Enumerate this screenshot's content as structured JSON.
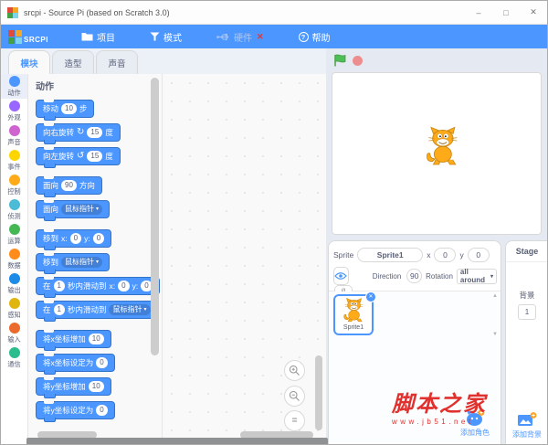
{
  "window": {
    "title": "srcpi - Source Pi (based on Scratch 3.0)"
  },
  "icons": {
    "minimize": "–",
    "maximize": "□",
    "close": "✕",
    "caret_down": "▾",
    "rotate_cw": "↻",
    "rotate_ccw": "↺",
    "help_q": "?",
    "hardware_x": "✕",
    "scroll_up": "▲",
    "scroll_down": "▼",
    "zoom_reset": "=",
    "sprite_close": "✕",
    "hide_eye": "ø"
  },
  "menu": {
    "brand": "SRCPI",
    "items": [
      {
        "label": "项目",
        "disabled": false
      },
      {
        "label": "模式",
        "disabled": false
      },
      {
        "label": "硬件",
        "disabled": true
      },
      {
        "label": "帮助",
        "disabled": false
      }
    ]
  },
  "tabs": [
    {
      "label": "模块",
      "active": true
    },
    {
      "label": "造型",
      "active": false
    },
    {
      "label": "声音",
      "active": false
    }
  ],
  "categories": [
    {
      "label": "动作",
      "color": "#4C97FF",
      "selected": true
    },
    {
      "label": "外观",
      "color": "#9966FF",
      "selected": false
    },
    {
      "label": "声音",
      "color": "#CF63CF",
      "selected": false
    },
    {
      "label": "事件",
      "color": "#FFD500",
      "selected": false
    },
    {
      "label": "控制",
      "color": "#FFAB19",
      "selected": false
    },
    {
      "label": "侦测",
      "color": "#4CBCD6",
      "selected": false
    },
    {
      "label": "运算",
      "color": "#45B854",
      "selected": false
    },
    {
      "label": "数据",
      "color": "#FF8C1A",
      "selected": false
    },
    {
      "label": "输出",
      "color": "#1C8CE8",
      "selected": false
    },
    {
      "label": "感知",
      "color": "#E0B50E",
      "selected": false
    },
    {
      "label": "输入",
      "color": "#EB6B2E",
      "selected": false
    },
    {
      "label": "通信",
      "color": "#2BBD8E",
      "selected": false
    }
  ],
  "palette": {
    "header": "动作",
    "blocks": [
      {
        "gap": false,
        "parts": [
          [
            "t",
            "移动"
          ],
          [
            "n",
            "10"
          ],
          [
            "t",
            "步"
          ]
        ]
      },
      {
        "gap": false,
        "parts": [
          [
            "t",
            "向右旋转"
          ],
          [
            "i",
            "↻"
          ],
          [
            "n",
            "15"
          ],
          [
            "t",
            "度"
          ]
        ]
      },
      {
        "gap": false,
        "parts": [
          [
            "t",
            "向左旋转"
          ],
          [
            "i",
            "↺"
          ],
          [
            "n",
            "15"
          ],
          [
            "t",
            "度"
          ]
        ]
      },
      {
        "gap": true,
        "parts": [
          [
            "t",
            "面向"
          ],
          [
            "n",
            "90"
          ],
          [
            "t",
            "方向"
          ]
        ]
      },
      {
        "gap": false,
        "parts": [
          [
            "t",
            "面向"
          ],
          [
            "d",
            "鼠标指针"
          ]
        ]
      },
      {
        "gap": true,
        "parts": [
          [
            "t",
            "移到"
          ],
          [
            "t",
            "x:"
          ],
          [
            "n",
            "0"
          ],
          [
            "t",
            "y:"
          ],
          [
            "n",
            "0"
          ]
        ]
      },
      {
        "gap": false,
        "parts": [
          [
            "t",
            "移到"
          ],
          [
            "d",
            "鼠标指针"
          ]
        ]
      },
      {
        "gap": false,
        "parts": [
          [
            "t",
            "在"
          ],
          [
            "n",
            "1"
          ],
          [
            "t",
            "秒内滑动到"
          ],
          [
            "t",
            "x:"
          ],
          [
            "n",
            "0"
          ],
          [
            "t",
            "y:"
          ],
          [
            "n",
            "0"
          ]
        ]
      },
      {
        "gap": false,
        "parts": [
          [
            "t",
            "在"
          ],
          [
            "n",
            "1"
          ],
          [
            "t",
            "秒内滑动到"
          ],
          [
            "d",
            "鼠标指针"
          ]
        ]
      },
      {
        "gap": true,
        "parts": [
          [
            "t",
            "将x坐标增加"
          ],
          [
            "n",
            "10"
          ]
        ]
      },
      {
        "gap": false,
        "parts": [
          [
            "t",
            "将x坐标设定为"
          ],
          [
            "n",
            "0"
          ]
        ]
      },
      {
        "gap": false,
        "parts": [
          [
            "t",
            "将y坐标增加"
          ],
          [
            "n",
            "10"
          ]
        ]
      },
      {
        "gap": false,
        "parts": [
          [
            "t",
            "将y坐标设定为"
          ],
          [
            "n",
            "0"
          ]
        ]
      }
    ]
  },
  "sprite_panel": {
    "sprite_label": "Sprite",
    "sprite_name": "Sprite1",
    "x_label": "x",
    "x_value": "0",
    "y_label": "y",
    "y_value": "0",
    "direction_label": "Direction",
    "direction_value": "90",
    "rotation_label": "Rotation",
    "rotation_value": "all around",
    "thumb_name": "Sprite1",
    "add_sprite_label": "添加角色"
  },
  "stage_panel": {
    "title": "Stage",
    "backdrop_label": "背景",
    "backdrop_value": "1",
    "add_backdrop_label": "添加背景"
  },
  "watermark": {
    "line1": "脚本之家",
    "line2": "www.jb51.net"
  },
  "colors": {
    "menu_bar": "#4C97FF",
    "motion_block": "#4C97FF",
    "motion_border": "#3373CC",
    "motion_dropdown": "#4280D7",
    "accent": "#4C97FF",
    "watermark_red": "#E0312E"
  }
}
